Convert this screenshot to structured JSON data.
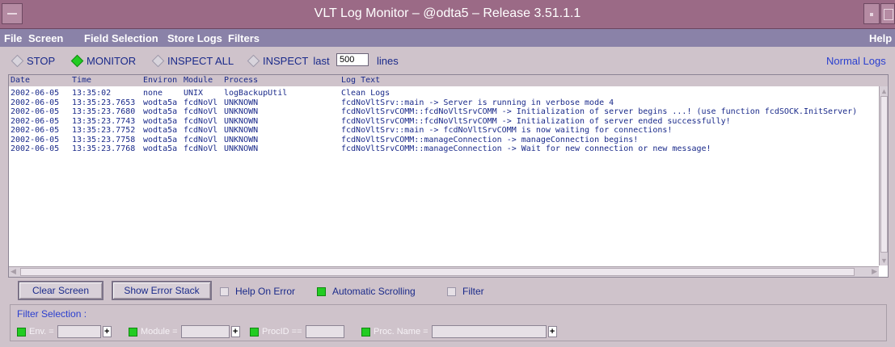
{
  "window": {
    "title": "VLT Log Monitor – @odta5 – Release 3.51.1.1"
  },
  "menu": {
    "file": "File",
    "screen": "Screen",
    "field_selection": "Field Selection",
    "store_logs": "Store Logs",
    "filters": "Filters",
    "help": "Help"
  },
  "modes": {
    "stop": "STOP",
    "monitor": "MONITOR",
    "inspect_all": "INSPECT ALL",
    "inspect": "INSPECT",
    "last_label": "last",
    "last_value": "500",
    "lines_label": "lines",
    "selected": "monitor",
    "normal_logs": "Normal Logs"
  },
  "log": {
    "columns": {
      "date": "Date",
      "time": "Time",
      "environ": "Environ",
      "module": "Module",
      "process": "Process",
      "log_text": "Log Text"
    },
    "rows": [
      {
        "date": "2002-06-05",
        "time": "13:35:02",
        "environ": "none",
        "module": "UNIX",
        "process": "logBackupUtil",
        "text": "Clean Logs"
      },
      {
        "date": "2002-06-05",
        "time": "13:35:23.7653",
        "environ": "wodta5a",
        "module": "fcdNoVl",
        "process": "UNKNOWN",
        "text": "fcdNoVltSrv::main -> Server is running in verbose mode 4"
      },
      {
        "date": "2002-06-05",
        "time": "13:35:23.7680",
        "environ": "wodta5a",
        "module": "fcdNoVl",
        "process": "UNKNOWN",
        "text": "fcdNoVltSrvCOMM::fcdNoVltSrvCOMM -> Initialization of server begins ...! (use function fcdSOCK.InitServer)"
      },
      {
        "date": "2002-06-05",
        "time": "13:35:23.7743",
        "environ": "wodta5a",
        "module": "fcdNoVl",
        "process": "UNKNOWN",
        "text": "fcdNoVltSrvCOMM::fcdNoVltSrvCOMM -> Initialization of server ended successfully!"
      },
      {
        "date": "2002-06-05",
        "time": "13:35:23.7752",
        "environ": "wodta5a",
        "module": "fcdNoVl",
        "process": "UNKNOWN",
        "text": "fcdNoVltSrv::main -> fcdNoVltSrvCOMM is now waiting for connections!"
      },
      {
        "date": "2002-06-05",
        "time": "13:35:23.7758",
        "environ": "wodta5a",
        "module": "fcdNoVl",
        "process": "UNKNOWN",
        "text": "fcdNoVltSrvCOMM::manageConnection -> manageConnection begins!"
      },
      {
        "date": "2002-06-05",
        "time": "13:35:23.7768",
        "environ": "wodta5a",
        "module": "fcdNoVl",
        "process": "UNKNOWN",
        "text": "fcdNoVltSrvCOMM::manageConnection -> Wait for new connection or new message!"
      }
    ]
  },
  "controls": {
    "clear_screen": "Clear Screen",
    "show_error_stack": "Show Error Stack",
    "help_on_error": "Help On Error",
    "help_on_error_checked": false,
    "automatic_scrolling": "Automatic Scrolling",
    "automatic_scrolling_checked": true,
    "filter": "Filter",
    "filter_checked": false
  },
  "filter_selection": {
    "label": "Filter Selection :",
    "env_label": "Env. =",
    "module_label": "Module =",
    "procid_label": "ProcID ==",
    "procname_label": "Proc. Name ="
  },
  "colors": {
    "title_bar": "#9b6a86",
    "menu_bar": "#8a82a8",
    "text": "#1a2a8a",
    "checked": "#22cc22"
  }
}
